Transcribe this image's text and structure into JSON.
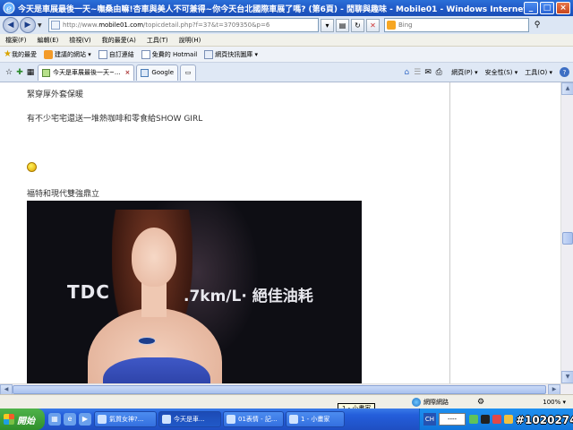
{
  "window": {
    "title": "今天是車展最後一天~嘸桑由嘛!杏車與美人不可兼得~你今天台北國際車展了嗎? (第6頁) - 閒聊與趣味 - Mobile01 - Windows Internet Explorer",
    "minimize": "_",
    "maximize": "□",
    "close": "×"
  },
  "address": {
    "url_prefix": "http://www.",
    "url_domain": "mobile01.com",
    "url_suffix": "/topicdetail.php?f=37&t=3709350&p=6",
    "back": "◀",
    "forward": "▶",
    "refresh": "↻",
    "stop": "✕"
  },
  "search": {
    "placeholder": "Bing"
  },
  "menu": [
    "檔案(F)",
    "編輯(E)",
    "檢視(V)",
    "我的最愛(A)",
    "工具(T)",
    "說明(H)"
  ],
  "favorites": {
    "label": "我的最愛",
    "items": [
      "建議的網站 ▾",
      "自訂連結",
      "免費的 Hotmail",
      "網頁快訊圖庫 ▾"
    ]
  },
  "tabs": {
    "items": [
      "今天是車展最後一天~...",
      "Google"
    ]
  },
  "commands": {
    "page": "網頁(P) ▾",
    "safety": "安全性(S) ▾",
    "tools": "工具(O) ▾",
    "help": "?"
  },
  "content": {
    "line1": "緊穿厚外套保暖",
    "line2": "有不少宅宅還送一堆熱咖啡和零食給SHOW GIRL",
    "line3": "福特和現代雙強鼎立",
    "photo_text_1": "TDC",
    "photo_text_2": ".7km/L· 絕佳油耗"
  },
  "status": {
    "zone": "網際網路",
    "zoom": "100% ▾"
  },
  "tooltip": "1 - 小畫家",
  "taskbar": {
    "start": "開始",
    "buttons": [
      "氣質女神?...",
      "今天是車...",
      "01表情 - 記...",
      "1 - 小畫家"
    ],
    "ime_lang": "CH",
    "ime_box": "----"
  },
  "watermark": "#1020274"
}
